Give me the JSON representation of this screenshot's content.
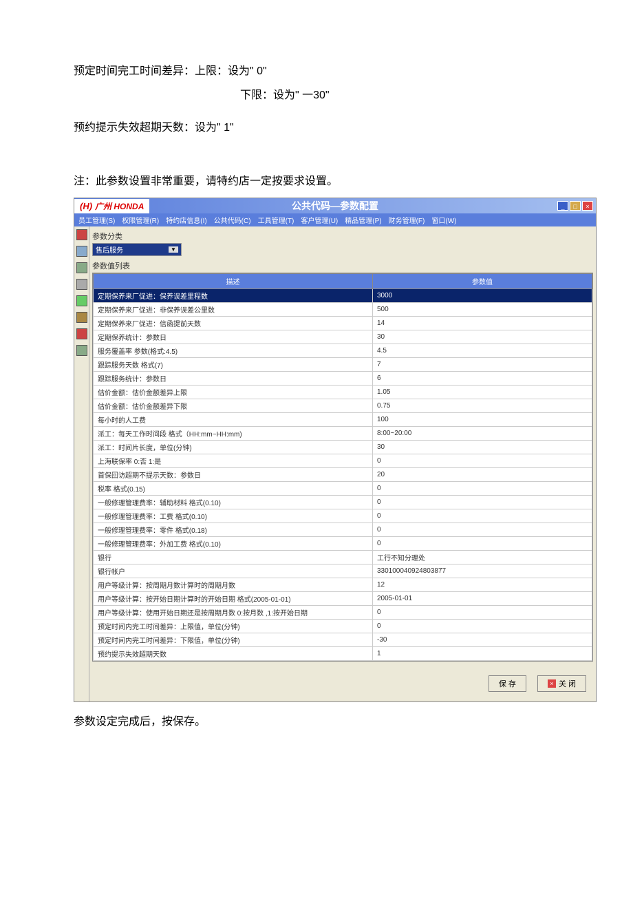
{
  "instructions": {
    "line1": "预定时间完工时间差异：上限：设为\" 0\"",
    "line2": "下限：设为\" 一30\"",
    "line3": "预约提示失效超期天数：设为\" 1\"",
    "note": "注：此参数设置非常重要，请特约店一定按要求设置。",
    "final": "参数设定完成后，按保存。"
  },
  "app": {
    "brand": "广州 HONDA",
    "title": "公共代码—参数配置",
    "menu": [
      "员工管理(S)",
      "权限管理(R)",
      "特约店信息(I)",
      "公共代码(C)",
      "工具管理(T)",
      "客户管理(U)",
      "精品管理(P)",
      "财务管理(F)",
      "窗口(W)"
    ],
    "section1": "参数分类",
    "dropdown_value": "售后服务",
    "section2": "参数值列表",
    "headers": {
      "desc": "描述",
      "value": "参数值"
    },
    "rows": [
      {
        "desc": "定期保养来厂促进：保养误差里程数",
        "val": "3000",
        "selected": true
      },
      {
        "desc": "定期保养来厂促进：非保养误差公里数",
        "val": "500"
      },
      {
        "desc": "定期保养来厂促进：信函提前天数",
        "val": "14"
      },
      {
        "desc": "定期保养统计：参数日",
        "val": "30"
      },
      {
        "desc": "服务覆盖率 参数(格式:4.5)",
        "val": "4.5"
      },
      {
        "desc": "跟踪服务天数 格式(7)",
        "val": "7"
      },
      {
        "desc": "跟踪服务统计：参数日",
        "val": "6"
      },
      {
        "desc": "估价金额：估价金额差异上限",
        "val": "1.05"
      },
      {
        "desc": "估价金额：估价金额差异下限",
        "val": "0.75"
      },
      {
        "desc": "每小时的人工费",
        "val": "100"
      },
      {
        "desc": "派工：每天工作时间段  格式（HH:mm~HH:mm)",
        "val": "8:00~20:00"
      },
      {
        "desc": "派工：时间片长度，单位(分钟)",
        "val": "30"
      },
      {
        "desc": "上海联保率 0:否 1:是",
        "val": "0"
      },
      {
        "desc": "首保回访超期不提示天数：参数日",
        "val": "20"
      },
      {
        "desc": "税率 格式(0.15)",
        "val": "0"
      },
      {
        "desc": "一般修理管理费率：辅助材料 格式(0.10)",
        "val": "0"
      },
      {
        "desc": "一般修理管理费率：工费 格式(0.10)",
        "val": "0"
      },
      {
        "desc": "一般修理管理费率：零件 格式(0.18)",
        "val": "0"
      },
      {
        "desc": "一般修理管理费率：外加工费 格式(0.10)",
        "val": "0"
      },
      {
        "desc": "银行",
        "val": "工行不知分理处"
      },
      {
        "desc": "银行帐户",
        "val": "330100040924803877"
      },
      {
        "desc": "用户等级计算：按周期月数计算时的周期月数",
        "val": "12"
      },
      {
        "desc": "用户等级计算：按开始日期计算时的开始日期 格式(2005-01-01)",
        "val": "2005-01-01"
      },
      {
        "desc": "用户等级计算：使用开始日期还是按周期月数 0:按月数 ,1:按开始日期",
        "val": "0"
      },
      {
        "desc": "预定时间内完工时间差异：上限值，单位(分钟)",
        "val": "0"
      },
      {
        "desc": "预定时间内完工时间差异：下限值，单位(分钟)",
        "val": "-30"
      },
      {
        "desc": "预约提示失效超期天数",
        "val": "1"
      }
    ],
    "buttons": {
      "save": "保 存",
      "close": "关 闭"
    }
  }
}
